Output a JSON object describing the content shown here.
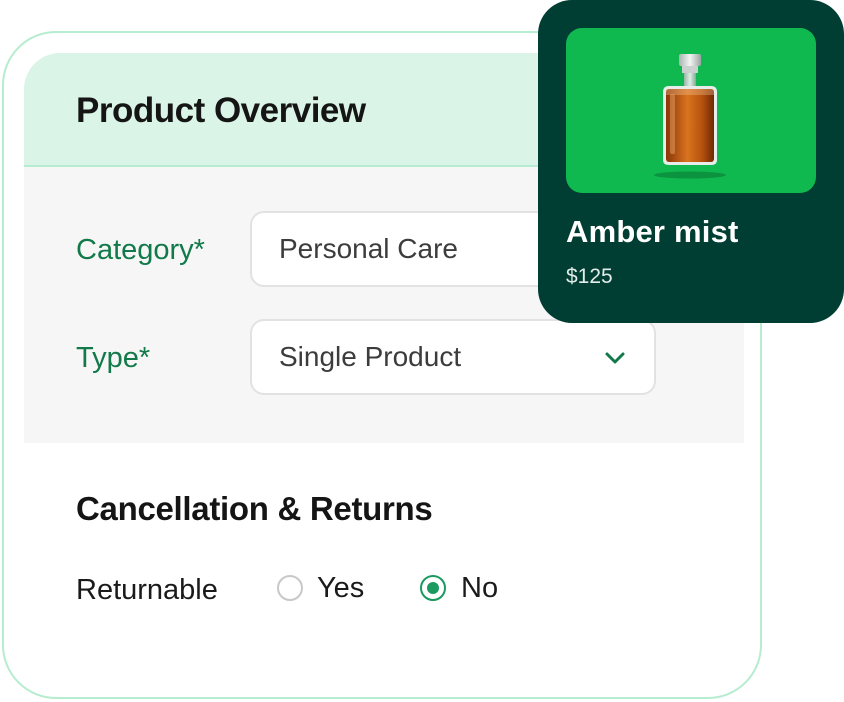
{
  "overview": {
    "title": "Product Overview",
    "fields": [
      {
        "label": "Category*",
        "value": "Personal Care"
      },
      {
        "label": "Type*",
        "value": "Single Product"
      }
    ]
  },
  "returns": {
    "title": "Cancellation & Returns",
    "label": "Returnable",
    "options": [
      {
        "label": "Yes",
        "selected": false
      },
      {
        "label": "No",
        "selected": true
      }
    ]
  },
  "product": {
    "name": "Amber mist",
    "price": "$125",
    "image_icon": "perfume-bottle-icon"
  },
  "colors": {
    "accent": "#1a9a5e",
    "label_green": "#127a4a",
    "header_bg": "#daf5e8",
    "card_border": "#b6ecd0",
    "product_card_bg": "#003d32",
    "product_image_bg": "#10b94f"
  }
}
